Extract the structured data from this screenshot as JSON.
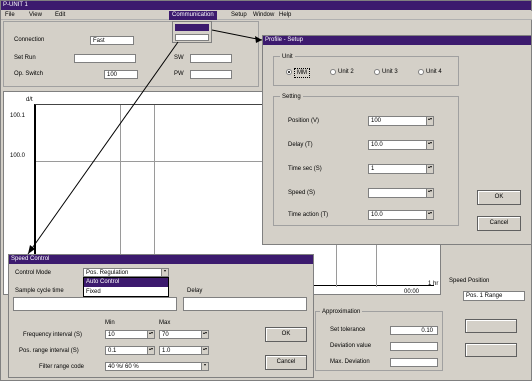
{
  "main": {
    "title": "P-UNIT 1",
    "menu": [
      "File",
      "View",
      "Edit",
      "Communication",
      "Setup",
      "Window",
      "Help"
    ],
    "menu_active_index": 3,
    "connection_label": "Connection",
    "connection_value": "Fast",
    "set_run_label": "Set Run",
    "set_run_value": "",
    "op_switch_label": "Op. Switch",
    "op_switch_value": "100",
    "sw_label": "SW",
    "sw_value": "",
    "pw_label": "PW",
    "pw_value": "",
    "chart": {
      "y_axis_label": "d/t",
      "y_tick_top": "100.1",
      "y_tick_mid": "100.0",
      "x_unit": "1 hr",
      "x_value": "00:00"
    },
    "speed_position_label": "Speed Position",
    "speed_position_value": "Pos. 1 Range",
    "approximation": {
      "title": "Approximation",
      "rows": [
        {
          "label": "Set tolerance",
          "value": "0.10"
        },
        {
          "label": "Deviation value",
          "value": ""
        },
        {
          "label": "Max. Deviation",
          "value": ""
        }
      ]
    }
  },
  "profile_window": {
    "title": "Profile - Setup",
    "unit_group_label": "Unit",
    "units": [
      {
        "label": "MM",
        "selected": true
      },
      {
        "label": "Unit 2",
        "selected": false
      },
      {
        "label": "Unit 3",
        "selected": false
      },
      {
        "label": "Unit 4",
        "selected": false
      }
    ],
    "setting_group_label": "Setting",
    "settings": [
      {
        "label": "Position (V)",
        "value": "100"
      },
      {
        "label": "Delay (T)",
        "value": "10.0"
      },
      {
        "label": "Time sec (S)",
        "value": "1"
      },
      {
        "label": "Speed (S)",
        "value": ""
      },
      {
        "label": "Time action (T)",
        "value": "10.0"
      }
    ],
    "ok_label": "OK",
    "cancel_label": "Cancel"
  },
  "control_window": {
    "title": "Speed Control",
    "control_mode_label": "Control Mode",
    "control_mode_value": "Pos. Regulation",
    "dropdown_options": [
      "Auto Control",
      "Fixed"
    ],
    "dropdown_selected_index": 0,
    "sample_label": "Sample cycle time",
    "delay_label": "Delay",
    "col_min": "Min",
    "col_max": "Max",
    "rows": [
      {
        "label": "Frequency interval (S)",
        "min": "10",
        "max": "70"
      },
      {
        "label": "Pos. range interval (S)",
        "min": "0.1",
        "max": "1.0"
      },
      {
        "label": "Filter range code",
        "min": "40 %/ 60 %",
        "max": ""
      }
    ],
    "ok_label": "OK",
    "cancel_label": "Cancel"
  }
}
